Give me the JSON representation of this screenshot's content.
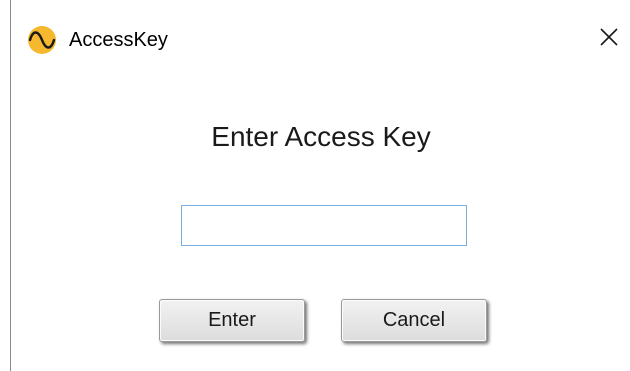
{
  "window": {
    "title": "AccessKey",
    "app_icon": "sine-wave-icon",
    "close_icon": "close-icon"
  },
  "dialog": {
    "heading": "Enter Access Key",
    "input": {
      "value": "",
      "placeholder": ""
    },
    "enter_label": "Enter",
    "cancel_label": "Cancel"
  },
  "colors": {
    "app_icon_bg": "#f5b82e",
    "input_border": "#7aaee0"
  }
}
